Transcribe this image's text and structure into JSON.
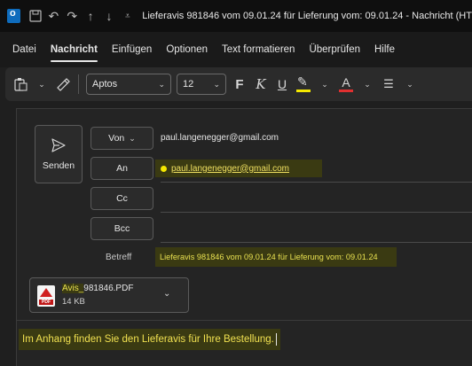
{
  "titlebar": {
    "title": "Lieferavis 981846 vom 09.01.24 für Lieferung vom: 09.01.24  -  Nachricht (HT"
  },
  "menu": {
    "items": [
      "Datei",
      "Nachricht",
      "Einfügen",
      "Optionen",
      "Text formatieren",
      "Überprüfen",
      "Hilfe"
    ],
    "active": "Nachricht"
  },
  "ribbon": {
    "font": "Aptos",
    "size": "12",
    "bold": "F",
    "italic": "K",
    "underline": "U",
    "font_color_letter": "A"
  },
  "compose": {
    "send_label": "Senden",
    "von_label": "Von",
    "from": "paul.langenegger@gmail.com",
    "an_label": "An",
    "to": "paul.langenegger@gmail.com",
    "cc_label": "Cc",
    "bcc_label": "Bcc",
    "subject_label": "Betreff",
    "subject": "Lieferavis 981846 vom 09.01.24 für Lieferung vom: 09.01.24"
  },
  "attachment": {
    "name_prefix": "Avis_",
    "name_rest": "981846.PDF",
    "size": "14 KB",
    "icon_tag": "PDF"
  },
  "body": {
    "text": "Im Anhang finden Sie den Lieferavis für Ihre Bestellung."
  },
  "colors": {
    "highlight": "#f4e800",
    "font_color": "#e03030",
    "accent": "#0f6cbd"
  }
}
